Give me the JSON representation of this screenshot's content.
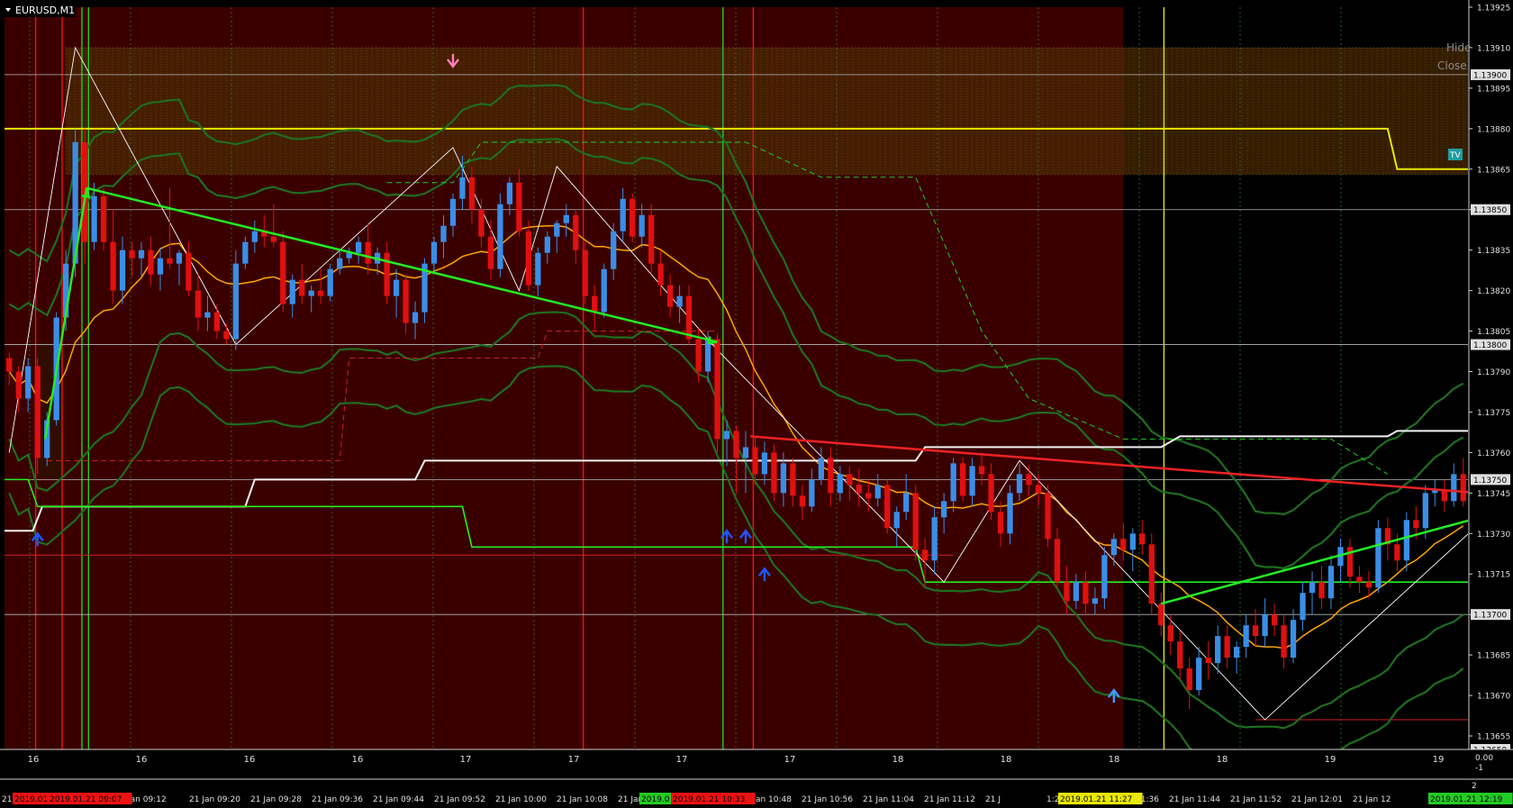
{
  "window": {
    "title": "EURUSD,M1",
    "hide_label": "Hide",
    "close_label": "Close",
    "tv_label": "TV"
  },
  "colors": {
    "background": "#000000",
    "zone": "#3a0000",
    "bull": "#3a8ee6",
    "bear": "#e01010",
    "ma": "#ffa500",
    "band": "#1e6e1e",
    "trend_green": "#22ee22",
    "trend_red": "#ee2222"
  },
  "chart_data": {
    "type": "candlestick",
    "symbol": "EURUSD",
    "timeframe": "M1",
    "ylim": [
      1.1365,
      1.13925
    ],
    "y_ticks": [
      "1.13925",
      "1.13910",
      "1.13895",
      "1.13880",
      "1.13865",
      "1.13850",
      "1.13835",
      "1.13820",
      "1.13805",
      "1.13790",
      "1.13775",
      "1.13760",
      "1.13745",
      "1.13730",
      "1.13715",
      "1.13700",
      "1.13685",
      "1.13670",
      "1.13655"
    ],
    "price_labels": [
      "1.13900",
      "1.13850",
      "1.13800",
      "1.13750",
      "1.13700",
      "1.13650"
    ],
    "horizontal_lines": [
      1.139,
      1.1385,
      1.138,
      1.1375,
      1.137
    ],
    "x_labels": [
      "Jan 09:12",
      "21 Jan 09:20",
      "21 Jan 09:28",
      "21 Jan 09:36",
      "21 Jan 09:44",
      "21 Jan 09:52",
      "21 Jan 10:00",
      "21 Jan 10:08",
      "21 Jan 10:16",
      "21 Jan 10:40",
      "21 Jan 10:48",
      "21 Jan 10:56",
      "21 Jan 11:04",
      "21 Jan 11:12",
      "21 J",
      "1:28",
      "21 Jan 11:36",
      "21 Jan 11:44",
      "21 Jan 11:52",
      "21 Jan 12:01",
      "21 Jan 12"
    ],
    "x_highlights": [
      {
        "text": "2019.01",
        "color": "#ee1111"
      },
      {
        "text": "2019.01.21 09:07",
        "color": "#ee1111"
      },
      {
        "text": "2019.0",
        "color": "#22cc22"
      },
      {
        "text": "2019.01.21 10:33",
        "color": "#ee1111"
      },
      {
        "text": "2019.01.21 11:27",
        "color": "#e8e800"
      },
      {
        "text": "2019.01.21 12:19",
        "color": "#22cc22"
      }
    ],
    "x_left_label": "21",
    "x_right_label": "2",
    "sub_labels": [
      "16",
      "16",
      "16",
      "16",
      "17",
      "17",
      "17",
      "17",
      "18",
      "18",
      "18",
      "18",
      "19",
      "19"
    ],
    "sub_right_values": [
      "0.00",
      "-1"
    ],
    "candles": [
      [
        1.13795,
        1.13797,
        1.13785,
        1.1379
      ],
      [
        1.1379,
        1.13792,
        1.13775,
        1.1378
      ],
      [
        1.1378,
        1.13795,
        1.13775,
        1.13792
      ],
      [
        1.13792,
        1.13795,
        1.13752,
        1.13758
      ],
      [
        1.13758,
        1.13775,
        1.13755,
        1.13772
      ],
      [
        1.13772,
        1.13812,
        1.1377,
        1.1381
      ],
      [
        1.1381,
        1.13835,
        1.13805,
        1.1383
      ],
      [
        1.1383,
        1.1388,
        1.13825,
        1.13875
      ],
      [
        1.13875,
        1.1388,
        1.1383,
        1.13838
      ],
      [
        1.13838,
        1.1386,
        1.13835,
        1.13855
      ],
      [
        1.13855,
        1.13858,
        1.13835,
        1.13838
      ],
      [
        1.13838,
        1.1385,
        1.13815,
        1.1382
      ],
      [
        1.1382,
        1.1384,
        1.13815,
        1.13835
      ],
      [
        1.13835,
        1.13838,
        1.13825,
        1.13832
      ],
      [
        1.13832,
        1.13838,
        1.13825,
        1.13835
      ],
      [
        1.13835,
        1.1384,
        1.13822,
        1.13826
      ],
      [
        1.13826,
        1.13836,
        1.1382,
        1.13832
      ],
      [
        1.13832,
        1.13858,
        1.13828,
        1.1383
      ],
      [
        1.1383,
        1.13835,
        1.13822,
        1.13834
      ],
      [
        1.13834,
        1.13838,
        1.13818,
        1.1382
      ],
      [
        1.1382,
        1.13826,
        1.13805,
        1.1381
      ],
      [
        1.1381,
        1.13818,
        1.13805,
        1.13812
      ],
      [
        1.13812,
        1.13815,
        1.13802,
        1.13805
      ],
      [
        1.13805,
        1.13808,
        1.138,
        1.13802
      ],
      [
        1.13802,
        1.13835,
        1.13798,
        1.1383
      ],
      [
        1.1383,
        1.1384,
        1.13828,
        1.13838
      ],
      [
        1.13838,
        1.13846,
        1.13834,
        1.13842
      ],
      [
        1.13842,
        1.13848,
        1.13836,
        1.1384
      ],
      [
        1.1384,
        1.13852,
        1.13836,
        1.13838
      ],
      [
        1.13838,
        1.13842,
        1.13812,
        1.13815
      ],
      [
        1.13815,
        1.13826,
        1.1381,
        1.13824
      ],
      [
        1.13824,
        1.1383,
        1.13815,
        1.13818
      ],
      [
        1.13818,
        1.13822,
        1.13812,
        1.1382
      ],
      [
        1.1382,
        1.13828,
        1.13815,
        1.13818
      ],
      [
        1.13818,
        1.1383,
        1.13816,
        1.13828
      ],
      [
        1.13828,
        1.13835,
        1.13826,
        1.13832
      ],
      [
        1.13832,
        1.13836,
        1.1383,
        1.13834
      ],
      [
        1.13834,
        1.1384,
        1.1383,
        1.13838
      ],
      [
        1.13838,
        1.13845,
        1.13826,
        1.1383
      ],
      [
        1.1383,
        1.13836,
        1.13826,
        1.13834
      ],
      [
        1.13834,
        1.13838,
        1.13815,
        1.13818
      ],
      [
        1.13818,
        1.13828,
        1.1381,
        1.13824
      ],
      [
        1.13824,
        1.13826,
        1.13804,
        1.13808
      ],
      [
        1.13808,
        1.13816,
        1.13802,
        1.13812
      ],
      [
        1.13812,
        1.13832,
        1.13808,
        1.1383
      ],
      [
        1.1383,
        1.1384,
        1.13826,
        1.13838
      ],
      [
        1.13838,
        1.13848,
        1.13832,
        1.13844
      ],
      [
        1.13844,
        1.13856,
        1.1384,
        1.13854
      ],
      [
        1.13854,
        1.1387,
        1.1385,
        1.13862
      ],
      [
        1.13862,
        1.13866,
        1.13845,
        1.1385
      ],
      [
        1.1385,
        1.13854,
        1.13836,
        1.1384
      ],
      [
        1.1384,
        1.13846,
        1.13824,
        1.13828
      ],
      [
        1.13828,
        1.13856,
        1.13825,
        1.13852
      ],
      [
        1.13852,
        1.13862,
        1.13848,
        1.1386
      ],
      [
        1.1386,
        1.13865,
        1.1384,
        1.13842
      ],
      [
        1.13842,
        1.13846,
        1.1382,
        1.13822
      ],
      [
        1.13822,
        1.13836,
        1.13818,
        1.13834
      ],
      [
        1.13834,
        1.13842,
        1.1383,
        1.1384
      ],
      [
        1.1384,
        1.13846,
        1.13834,
        1.13845
      ],
      [
        1.13845,
        1.13852,
        1.1384,
        1.13848
      ],
      [
        1.13848,
        1.1385,
        1.1383,
        1.13835
      ],
      [
        1.13835,
        1.13838,
        1.13815,
        1.13818
      ],
      [
        1.13818,
        1.13822,
        1.13805,
        1.13812
      ],
      [
        1.13812,
        1.1383,
        1.1381,
        1.13828
      ],
      [
        1.13828,
        1.13845,
        1.13824,
        1.13842
      ],
      [
        1.13842,
        1.13858,
        1.13838,
        1.13854
      ],
      [
        1.13854,
        1.13856,
        1.13838,
        1.1384
      ],
      [
        1.1384,
        1.13852,
        1.13836,
        1.13848
      ],
      [
        1.13848,
        1.13852,
        1.13826,
        1.1383
      ],
      [
        1.1383,
        1.13835,
        1.13818,
        1.13822
      ],
      [
        1.13822,
        1.13826,
        1.1381,
        1.13814
      ],
      [
        1.13814,
        1.13822,
        1.13808,
        1.13818
      ],
      [
        1.13818,
        1.13822,
        1.138,
        1.13802
      ],
      [
        1.13802,
        1.13806,
        1.13786,
        1.1379
      ],
      [
        1.1379,
        1.13805,
        1.13786,
        1.13802
      ],
      [
        1.13802,
        1.13804,
        1.1376,
        1.13765
      ],
      [
        1.13765,
        1.13772,
        1.13755,
        1.13768
      ],
      [
        1.13768,
        1.1377,
        1.13745,
        1.13758
      ],
      [
        1.13758,
        1.13768,
        1.13745,
        1.13762
      ],
      [
        1.13762,
        1.13766,
        1.13748,
        1.13752
      ],
      [
        1.13752,
        1.13764,
        1.13748,
        1.1376
      ],
      [
        1.1376,
        1.13763,
        1.13742,
        1.13745
      ],
      [
        1.13745,
        1.1376,
        1.1374,
        1.13756
      ],
      [
        1.13756,
        1.13758,
        1.1374,
        1.13744
      ],
      [
        1.13744,
        1.13748,
        1.13735,
        1.1374
      ],
      [
        1.1374,
        1.13754,
        1.13738,
        1.1375
      ],
      [
        1.1375,
        1.13762,
        1.13748,
        1.13758
      ],
      [
        1.13758,
        1.13762,
        1.1374,
        1.13745
      ],
      [
        1.13745,
        1.13755,
        1.13742,
        1.13752
      ],
      [
        1.13752,
        1.13755,
        1.13742,
        1.13748
      ],
      [
        1.13748,
        1.13754,
        1.1374,
        1.13745
      ],
      [
        1.13745,
        1.1375,
        1.13738,
        1.13743
      ],
      [
        1.13743,
        1.13752,
        1.1374,
        1.13748
      ],
      [
        1.13748,
        1.1375,
        1.1373,
        1.13732
      ],
      [
        1.13732,
        1.1374,
        1.13725,
        1.13738
      ],
      [
        1.13738,
        1.13752,
        1.13735,
        1.13745
      ],
      [
        1.13745,
        1.13748,
        1.1372,
        1.13724
      ],
      [
        1.13724,
        1.13728,
        1.1371,
        1.1372
      ],
      [
        1.1372,
        1.1374,
        1.13715,
        1.13736
      ],
      [
        1.13736,
        1.13745,
        1.1373,
        1.13742
      ],
      [
        1.13742,
        1.13758,
        1.13738,
        1.13756
      ],
      [
        1.13756,
        1.13758,
        1.13742,
        1.13744
      ],
      [
        1.13744,
        1.13758,
        1.1374,
        1.13755
      ],
      [
        1.13755,
        1.1376,
        1.13748,
        1.13752
      ],
      [
        1.13752,
        1.13756,
        1.13735,
        1.13738
      ],
      [
        1.13738,
        1.13742,
        1.13725,
        1.1373
      ],
      [
        1.1373,
        1.13748,
        1.13726,
        1.13745
      ],
      [
        1.13745,
        1.13756,
        1.13742,
        1.13752
      ],
      [
        1.13752,
        1.13755,
        1.13744,
        1.13748
      ],
      [
        1.13748,
        1.13752,
        1.1374,
        1.13745
      ],
      [
        1.13745,
        1.13748,
        1.13725,
        1.13728
      ],
      [
        1.13728,
        1.13732,
        1.1371,
        1.13712
      ],
      [
        1.13712,
        1.13718,
        1.137,
        1.13705
      ],
      [
        1.13705,
        1.13715,
        1.13702,
        1.13712
      ],
      [
        1.13712,
        1.13716,
        1.137,
        1.13704
      ],
      [
        1.13704,
        1.1371,
        1.137,
        1.13706
      ],
      [
        1.13706,
        1.13725,
        1.13702,
        1.13722
      ],
      [
        1.13722,
        1.1373,
        1.13718,
        1.13728
      ],
      [
        1.13728,
        1.13734,
        1.1372,
        1.13724
      ],
      [
        1.13724,
        1.13732,
        1.13716,
        1.1373
      ],
      [
        1.1373,
        1.13735,
        1.13722,
        1.13726
      ],
      [
        1.13726,
        1.1373,
        1.137,
        1.13704
      ],
      [
        1.13704,
        1.13708,
        1.13692,
        1.13696
      ],
      [
        1.13696,
        1.137,
        1.13685,
        1.1369
      ],
      [
        1.1369,
        1.13694,
        1.13676,
        1.1368
      ],
      [
        1.1368,
        1.13684,
        1.13665,
        1.13672
      ],
      [
        1.13672,
        1.13688,
        1.1367,
        1.13684
      ],
      [
        1.13684,
        1.1369,
        1.13676,
        1.13682
      ],
      [
        1.13682,
        1.13696,
        1.13678,
        1.13692
      ],
      [
        1.13692,
        1.13696,
        1.1368,
        1.13684
      ],
      [
        1.13684,
        1.1369,
        1.13678,
        1.13688
      ],
      [
        1.13688,
        1.137,
        1.13684,
        1.13696
      ],
      [
        1.13696,
        1.13702,
        1.13688,
        1.13692
      ],
      [
        1.13692,
        1.13706,
        1.13688,
        1.137
      ],
      [
        1.137,
        1.13704,
        1.13692,
        1.13696
      ],
      [
        1.13696,
        1.137,
        1.1368,
        1.13684
      ],
      [
        1.13684,
        1.13702,
        1.13682,
        1.13698
      ],
      [
        1.13698,
        1.13712,
        1.13694,
        1.13708
      ],
      [
        1.13708,
        1.13716,
        1.137,
        1.13712
      ],
      [
        1.13712,
        1.13718,
        1.13702,
        1.13706
      ],
      [
        1.13706,
        1.13722,
        1.13702,
        1.13718
      ],
      [
        1.13718,
        1.13728,
        1.13712,
        1.13725
      ],
      [
        1.13725,
        1.13728,
        1.1371,
        1.13714
      ],
      [
        1.13714,
        1.13718,
        1.13708,
        1.13712
      ],
      [
        1.13712,
        1.13716,
        1.13706,
        1.1371
      ],
      [
        1.1371,
        1.13735,
        1.13708,
        1.13732
      ],
      [
        1.13732,
        1.13736,
        1.1372,
        1.13726
      ],
      [
        1.13726,
        1.1373,
        1.13716,
        1.1372
      ],
      [
        1.1372,
        1.13738,
        1.13716,
        1.13735
      ],
      [
        1.13735,
        1.1374,
        1.13728,
        1.13732
      ],
      [
        1.13732,
        1.13748,
        1.13728,
        1.13745
      ],
      [
        1.13745,
        1.1375,
        1.1374,
        1.13746
      ],
      [
        1.13746,
        1.1375,
        1.13738,
        1.13742
      ],
      [
        1.13742,
        1.13756,
        1.1374,
        1.13752
      ],
      [
        1.13752,
        1.13758,
        1.1374,
        1.13742
      ]
    ],
    "markers": [
      {
        "type": "arrow-down",
        "color": "#ee1111",
        "bar": 6,
        "price": 1.13922
      },
      {
        "type": "arrow-down",
        "color": "#ff7fbf",
        "bar": 47,
        "price": 1.13903
      },
      {
        "type": "arrow-up",
        "color": "#2255ff",
        "bar": 3,
        "price": 1.1373
      },
      {
        "type": "arrow-up",
        "color": "#2255ff",
        "bar": 76,
        "price": 1.13731
      },
      {
        "type": "arrow-up",
        "color": "#2255ff",
        "bar": 78,
        "price": 1.13731
      },
      {
        "type": "arrow-up",
        "color": "#2255ff",
        "bar": 80,
        "price": 1.13717
      },
      {
        "type": "arrow-up",
        "color": "#4499ff",
        "bar": 117,
        "price": 1.13672
      }
    ]
  }
}
